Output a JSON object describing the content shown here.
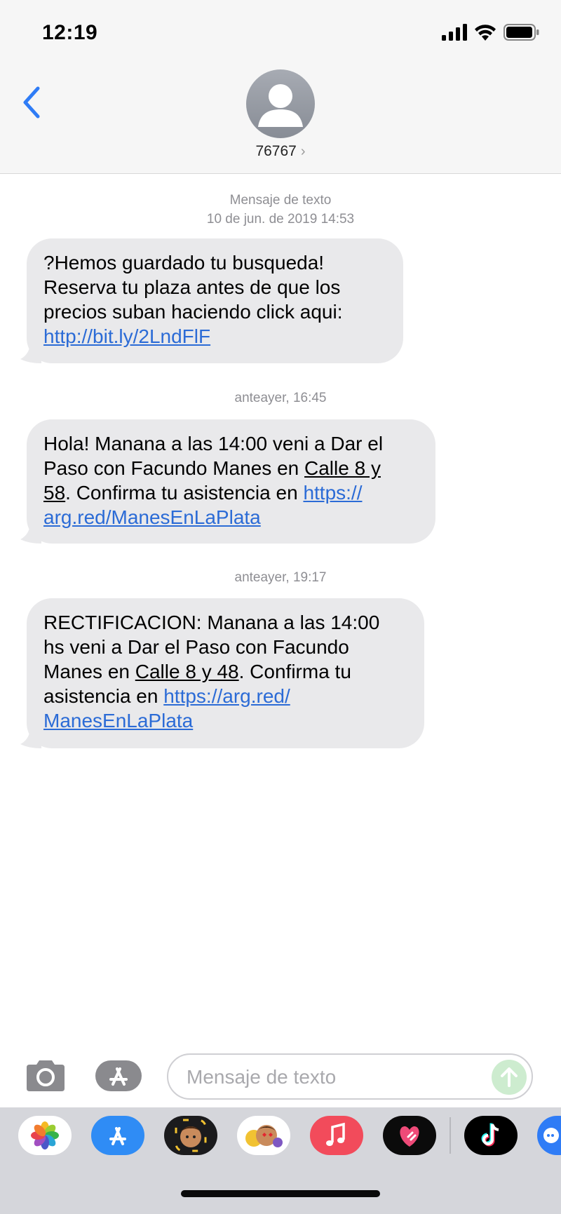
{
  "status_bar": {
    "time": "12:19",
    "icons": [
      "signal-icon",
      "wifi-icon",
      "battery-icon"
    ]
  },
  "header": {
    "contact": "76767",
    "chevron": "›"
  },
  "messages": [
    {
      "timestamp_line1": "Mensaje de texto",
      "timestamp_line2": "10 de jun. de 2019 14:53",
      "line1": "?Hemos guardado tu busqueda!",
      "line2": "Reserva tu plaza antes de que los",
      "line3": "precios suban haciendo click aqui:",
      "link": "http://bit.ly/2LndFlF"
    },
    {
      "timestamp": "anteayer, 16:45",
      "line1": "Hola! Manana a las 14:00 veni a Dar el",
      "line2_pre": "Paso con Facundo Manes en ",
      "line2_ul": "Calle 8 y",
      "line3_ul": "58",
      "line3_post": ". Confirma tu asistencia en ",
      "link_part1": "https://",
      "link_part2": "arg.red/ManesEnLaPlata"
    },
    {
      "timestamp": "anteayer, 19:17",
      "line1": "RECTIFICACION: Manana a las 14:00",
      "line2": "hs veni a Dar el Paso con Facundo",
      "line3_pre": "Manes en ",
      "line3_ul": "Calle 8 y 48",
      "line3_post": ". Confirma tu",
      "line4_pre": "asistencia en ",
      "link_part1": "https://arg.red/",
      "link_part2": "ManesEnLaPlata"
    }
  ],
  "input_bar": {
    "placeholder": "Mensaje de texto"
  },
  "app_strip": [
    "photos-icon",
    "app-store-icon",
    "memoji-icon",
    "animoji-icon",
    "music-icon",
    "digital-touch-icon",
    "tiktok-icon",
    "more-apps-icon"
  ],
  "colors": {
    "bubble": "#e9e9eb",
    "link": "#2b6bd6",
    "ios_blue": "#2f7cf6",
    "send": "#cdeccf"
  }
}
